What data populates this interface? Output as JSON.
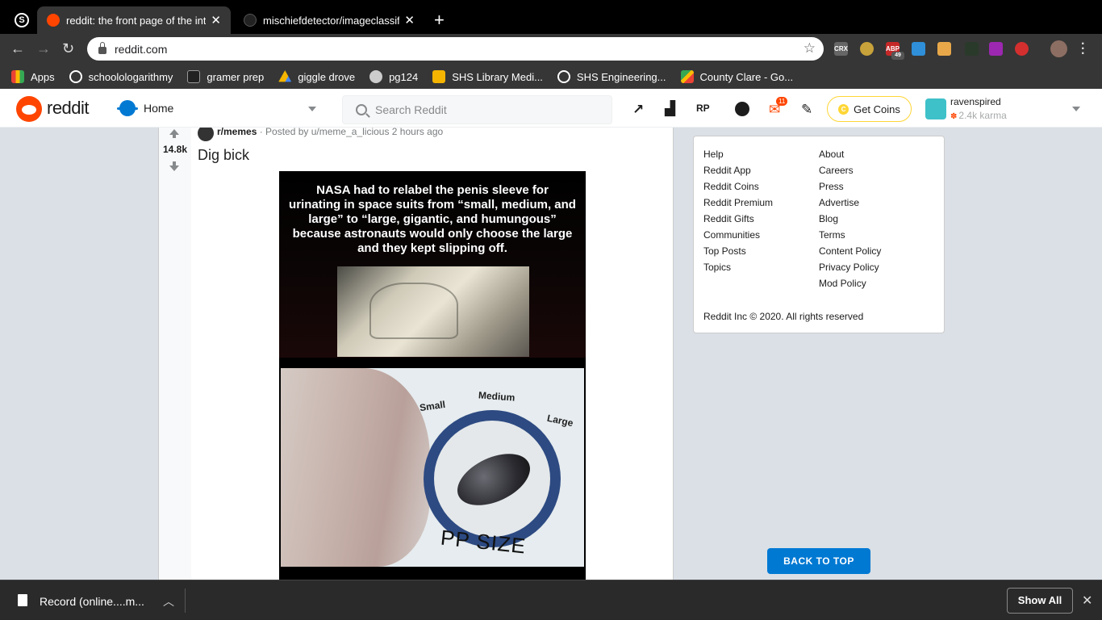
{
  "browser": {
    "tabs": [
      {
        "title": "reddit: the front page of the internet",
        "active": true
      },
      {
        "title": "mischiefdetector/imageclassifier",
        "active": false
      }
    ],
    "url": "reddit.com",
    "bookmarks": [
      {
        "label": "Apps",
        "icon": "apps-grid-icon"
      },
      {
        "label": "schoolologarithmy",
        "icon": "schoology-icon"
      },
      {
        "label": "gramer prep",
        "icon": "gb-icon"
      },
      {
        "label": "giggle drove",
        "icon": "google-drive-icon"
      },
      {
        "label": "pg124",
        "icon": "globe-icon"
      },
      {
        "label": "SHS Library Medi...",
        "icon": "library-icon"
      },
      {
        "label": "SHS Engineering...",
        "icon": "schoology-icon"
      },
      {
        "label": "County Clare - Go...",
        "icon": "google-maps-icon"
      }
    ],
    "extension_badge": "49"
  },
  "reddit_header": {
    "wordmark": "reddit",
    "home_label": "Home",
    "search_placeholder": "Search Reddit",
    "mail_count": "11",
    "get_coins": "Get Coins",
    "username": "ravenspired",
    "karma": "2.4k karma"
  },
  "post": {
    "score": "14.8k",
    "subreddit": "r/memes",
    "meta": "· Posted by u/meme_a_licious 2 hours ago",
    "title": "Dig bick",
    "image": {
      "caption": "NASA had to relabel the penis sleeve for urinating in space suits from “small, medium, and large” to “large, gigantic, and humungous” because astronauts would only choose the large and they kept slipping off.",
      "dial_small": "Small",
      "dial_medium": "Medium",
      "dial_large": "Large",
      "dial_text": "PP SIZE"
    }
  },
  "sidebar": {
    "left_links": [
      "Help",
      "Reddit App",
      "Reddit Coins",
      "Reddit Premium",
      "Reddit Gifts",
      "Communities",
      "Top Posts",
      "Topics"
    ],
    "right_links": [
      "About",
      "Careers",
      "Press",
      "Advertise",
      "Blog",
      "Terms",
      "Content Policy",
      "Privacy Policy",
      "Mod Policy"
    ],
    "copyright": "Reddit Inc © 2020. All rights reserved",
    "back_to_top": "BACK TO TOP"
  },
  "download_shelf": {
    "file_name": "Record (online....m...",
    "show_all": "Show All"
  },
  "colors": {
    "reddit_orange": "#ff4500",
    "reddit_blue": "#0079d3",
    "page_bg": "#dae0e6",
    "chrome_dark": "#363636"
  }
}
